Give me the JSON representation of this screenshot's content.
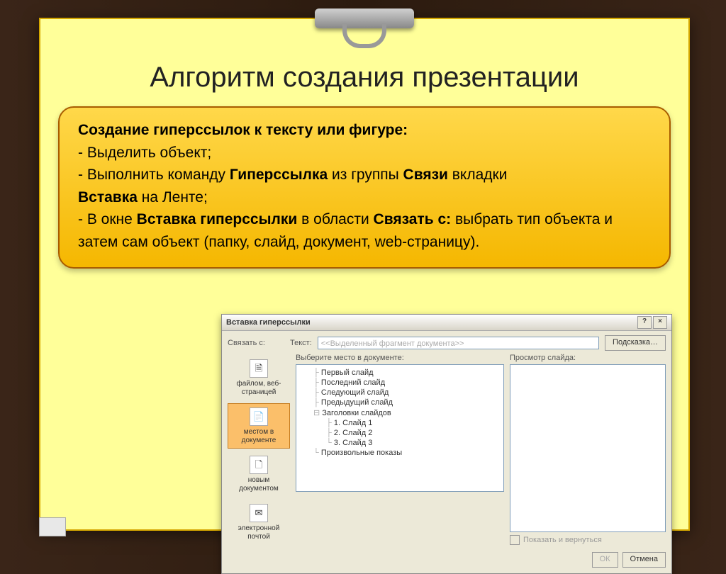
{
  "slide": {
    "title": "Алгоритм создания презентации",
    "heading": "Создание гиперссылок к тексту или фигуре:",
    "line1": "-  Выделить объект;",
    "line2a": "-  Выполнить команду  ",
    "line2b": "Гиперссылка",
    "line2c": " из группы  ",
    "line2d": "Связи",
    "line2e": " вкладки ",
    "line3a": "Вставка",
    "line3b": " на Ленте;",
    "line4a": "-  В окне ",
    "line4b": "Вставка гиперссылки",
    "line4c": " в области ",
    "line4d": "Связать с:",
    "line4e": " выбрать тип объекта и затем сам объект (папку, слайд, документ, web-страницу)."
  },
  "dialog": {
    "title": "Вставка гиперссылки",
    "help": "?",
    "close": "×",
    "link_with": "Связать с:",
    "text_lbl": "Текст:",
    "text_placeholder": "<<Выделенный фрагмент документа>>",
    "hint_btn": "Подсказка…",
    "sidebar": [
      {
        "icon": "🗎",
        "label": "файлом, веб-страницей",
        "selected": false
      },
      {
        "icon": "📄",
        "label": "местом в документе",
        "selected": true
      },
      {
        "icon": "🗋",
        "label": "новым документом",
        "selected": false
      },
      {
        "icon": "✉",
        "label": "электронной почтой",
        "selected": false
      }
    ],
    "tree_label": "Выберите место в документе:",
    "tree": {
      "n1": "Первый слайд",
      "n2": "Последний слайд",
      "n3": "Следующий слайд",
      "n4": "Предыдущий слайд",
      "n5": "Заголовки слайдов",
      "n5a": "1. Слайд 1",
      "n5b": "2. Слайд 2",
      "n5c": "3. Слайд 3",
      "n6": "Произвольные показы"
    },
    "preview_label": "Просмотр слайда:",
    "show_return": "Показать и вернуться",
    "ok": "ОК",
    "cancel": "Отмена"
  }
}
